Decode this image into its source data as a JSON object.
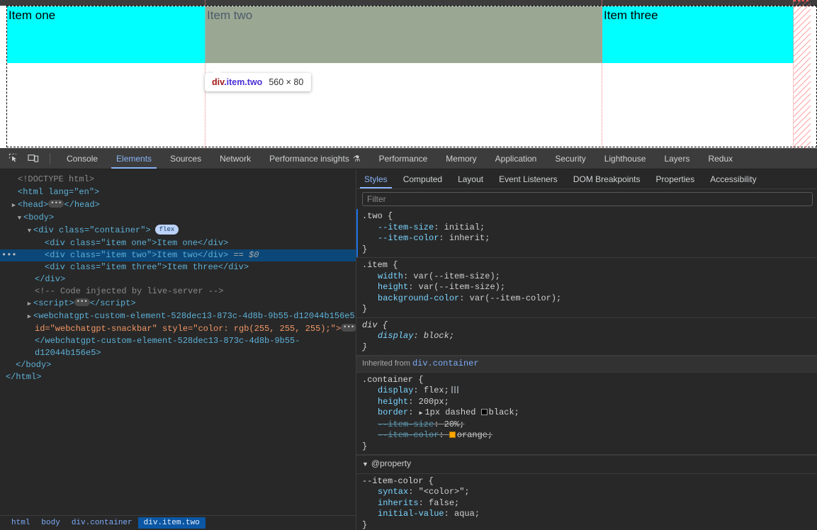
{
  "viewport": {
    "items": [
      {
        "label": "Item one",
        "class": "one",
        "color": "#00ffff"
      },
      {
        "label": "Item two",
        "class": "two",
        "color": "#9aa893"
      },
      {
        "label": "Item three",
        "class": "three",
        "color": "#00ffff"
      }
    ],
    "tooltip": {
      "tag": "div",
      "classes": ".item.two",
      "dimensions": "560 × 80"
    }
  },
  "devtools": {
    "toolbar_icons": [
      "inspect-element-icon",
      "device-toolbar-icon"
    ],
    "tabs": [
      {
        "label": "Console",
        "active": false
      },
      {
        "label": "Elements",
        "active": true
      },
      {
        "label": "Sources",
        "active": false
      },
      {
        "label": "Network",
        "active": false
      },
      {
        "label": "Performance insights",
        "active": false,
        "flask": "⚗"
      },
      {
        "label": "Performance",
        "active": false
      },
      {
        "label": "Memory",
        "active": false
      },
      {
        "label": "Application",
        "active": false
      },
      {
        "label": "Security",
        "active": false
      },
      {
        "label": "Lighthouse",
        "active": false
      },
      {
        "label": "Layers",
        "active": false
      },
      {
        "label": "Redux",
        "active": false
      }
    ],
    "dom": {
      "doctype": "<!DOCTYPE html>",
      "html_open": "<html lang=\"en\">",
      "head_line": "<head>",
      "head_close": "</head>",
      "body_open": "<body>",
      "container_open": "<div class=\"container\">",
      "container_badge": "flex",
      "item_one": "<div class=\"item one\">Item one</div>",
      "item_two": "<div class=\"item two\">Item two</div>",
      "item_two_marker": "== $0",
      "item_three": "<div class=\"item three\">Item three</div>",
      "container_close": "</div>",
      "comment": "<!-- Code injected by live-server -->",
      "script_line": "<script>",
      "script_close": "</script>",
      "custom_open": "<webchatgpt-custom-element-528dec13-873c-4d8b-9b55-d12044b156e5",
      "custom_attrs": "id=\"webchatgpt-snackbar\" style=\"color: rgb(255, 255, 255);\">",
      "custom_close_1": "</webchatgpt-custom-element-528dec13-873c-4d8b-9b55-",
      "custom_close_2": "d12044b156e5>",
      "body_close": "</body>",
      "html_close": "</html>"
    },
    "breadcrumb": [
      {
        "label": "html",
        "active": false
      },
      {
        "label": "body",
        "active": false
      },
      {
        "label": "div.container",
        "active": false
      },
      {
        "label": "div.item.two",
        "active": true
      }
    ],
    "sidebar_tabs": [
      {
        "label": "Styles",
        "active": true
      },
      {
        "label": "Computed",
        "active": false
      },
      {
        "label": "Layout",
        "active": false
      },
      {
        "label": "Event Listeners",
        "active": false
      },
      {
        "label": "DOM Breakpoints",
        "active": false
      },
      {
        "label": "Properties",
        "active": false
      },
      {
        "label": "Accessibility",
        "active": false
      }
    ],
    "filter": {
      "placeholder": "Filter",
      "value": ""
    },
    "rules": [
      {
        "selector": ".two {",
        "close": "}",
        "italic": false,
        "marker": true,
        "declarations": [
          {
            "prop": "--item-size",
            "value": "initial;",
            "struck": false
          },
          {
            "prop": "--item-color",
            "value": "inherit;",
            "struck": false
          }
        ]
      },
      {
        "selector": ".item {",
        "close": "}",
        "italic": false,
        "marker": false,
        "declarations": [
          {
            "prop": "width",
            "value": "var(--item-size);",
            "struck": false
          },
          {
            "prop": "height",
            "value": "var(--item-size);",
            "struck": false
          },
          {
            "prop": "background-color",
            "value": "var(--item-color);",
            "struck": false
          }
        ]
      },
      {
        "selector": "div {",
        "close": "}",
        "italic": true,
        "marker": false,
        "declarations": [
          {
            "prop": "display",
            "value": "block;",
            "struck": false
          }
        ]
      }
    ],
    "inherited_header": {
      "prefix": "Inherited from",
      "source": "div.container"
    },
    "container_rule": {
      "selector": ".container {",
      "close": "}",
      "declarations": [
        {
          "prop": "display",
          "value": "flex;",
          "struck": false,
          "icon": "flex-icon"
        },
        {
          "prop": "height",
          "value": "200px;",
          "struck": false
        },
        {
          "prop": "border",
          "value": "1px dashed",
          "struck": false,
          "swatch": "#000000",
          "swatch_label": "black;",
          "expand": "▶"
        },
        {
          "prop": "--item-size",
          "value": "20%;",
          "struck": true
        },
        {
          "prop": "--item-color",
          "value": "orange;",
          "struck": true,
          "swatch": "#ffa500",
          "swatch_label": "orange;"
        }
      ]
    },
    "at_property": {
      "header": "@property",
      "caret": "▼",
      "name": "--item-color {",
      "close": "}",
      "declarations": [
        {
          "prop": "syntax",
          "value": "\"<color>\";"
        },
        {
          "prop": "inherits",
          "value": "false;"
        },
        {
          "prop": "initial-value",
          "value": "aqua;"
        }
      ]
    }
  }
}
